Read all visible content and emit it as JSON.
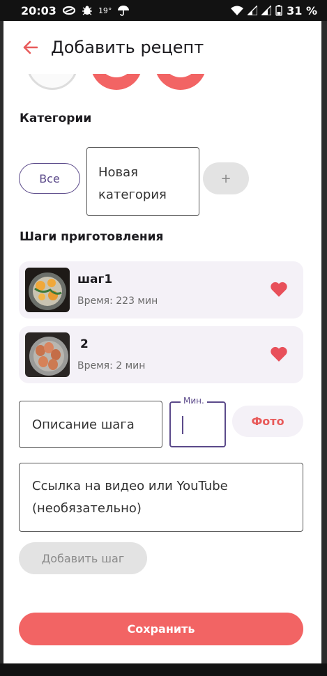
{
  "status_bar": {
    "time": "20:03",
    "temperature": "19°",
    "battery": "31 %"
  },
  "app_bar": {
    "title": "Добавить рецепт"
  },
  "categories": {
    "section_title": "Категории",
    "all_chip": "Все",
    "new_category_placeholder": "Новая категория",
    "add_button": "+"
  },
  "steps": {
    "section_title": "Шаги приготовления",
    "items": [
      {
        "name": "шаг1",
        "time": "Время: 223 мин"
      },
      {
        "name": "2",
        "time": "Время: 2 мин"
      }
    ]
  },
  "step_form": {
    "description_placeholder": "Описание шага",
    "minutes_label": "Мин.",
    "photo_button": "Фото",
    "video_placeholder": "Ссылка на видео или YouTube (необязательно)",
    "add_step_button": "Добавить шаг"
  },
  "save_button": "Сохранить",
  "colors": {
    "accent": "#f26464",
    "primary": "#5b4a8a",
    "card_bg": "#f4f1f7"
  }
}
